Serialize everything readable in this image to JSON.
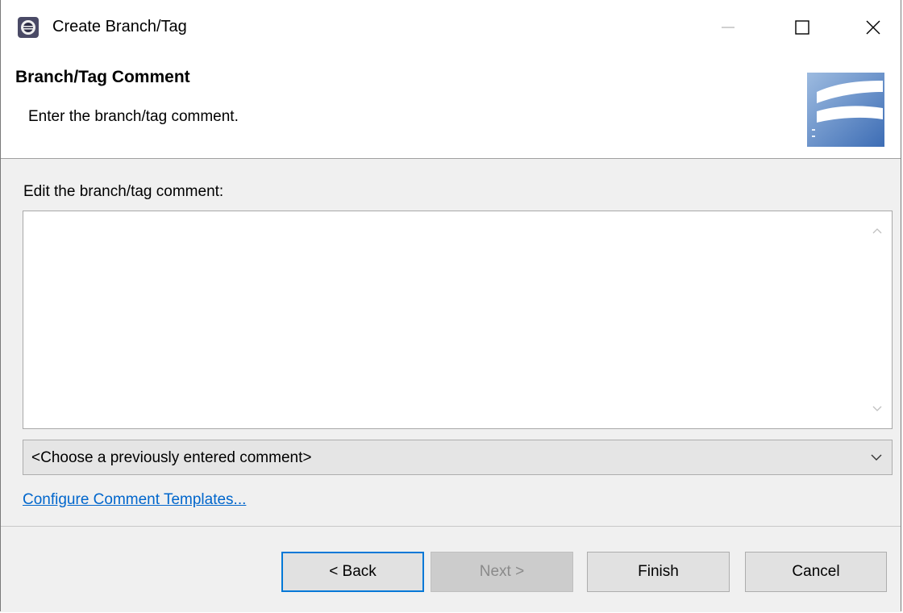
{
  "window": {
    "title": "Create Branch/Tag"
  },
  "header": {
    "title": "Branch/Tag Comment",
    "description": "Enter the branch/tag comment."
  },
  "content": {
    "edit_label": "Edit the branch/tag comment:",
    "comment_value": "",
    "previous_comment_combo": "<Choose a previously entered comment>",
    "config_link": "Configure Comment Templates..."
  },
  "buttons": {
    "back": "< Back",
    "next": "Next >",
    "finish": "Finish",
    "cancel": "Cancel"
  },
  "icons": {
    "app": "eclipse-app-icon",
    "banner": "subversion-banner-logo"
  },
  "colors": {
    "link": "#0066cc",
    "focus_border": "#0078d7",
    "dialog_bg": "#f0f0f0"
  }
}
